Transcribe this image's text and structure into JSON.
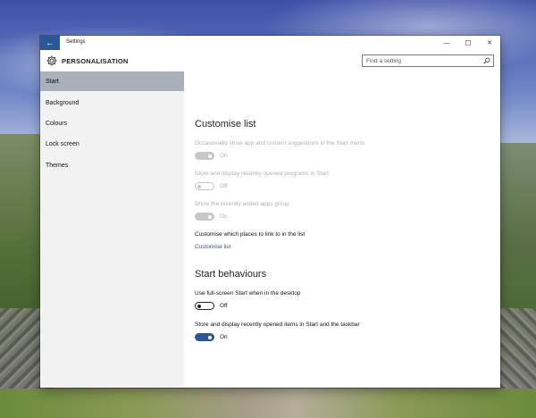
{
  "window": {
    "title": "Settings",
    "back_glyph": "←",
    "minimize_glyph": "—",
    "maximize_glyph": "☐",
    "close_glyph": "✕"
  },
  "header": {
    "title": "PERSONALISATION",
    "icon": "gear-icon",
    "search_placeholder": "Find a setting",
    "search_icon": "search-icon"
  },
  "sidebar": {
    "items": [
      {
        "label": "Start",
        "selected": true
      },
      {
        "label": "Background",
        "selected": false
      },
      {
        "label": "Colours",
        "selected": false
      },
      {
        "label": "Lock screen",
        "selected": false
      },
      {
        "label": "Themes",
        "selected": false
      }
    ]
  },
  "content": {
    "customise_list": {
      "heading": "Customise list",
      "suggestions": {
        "label": "Occasionally show app and content suggestions in the Start menu",
        "state": "On",
        "enabled": false
      },
      "recent_programs": {
        "label": "Store and display recently opened programs in Start",
        "state": "Off",
        "enabled": false
      },
      "recent_apps": {
        "label": "Show the recently added apps group",
        "state": "On",
        "enabled": false
      },
      "places_label": "Customise which places to link to in the list",
      "places_link": "Customise list"
    },
    "start_behaviours": {
      "heading": "Start behaviours",
      "full_screen": {
        "label": "Use full-screen Start when in the desktop",
        "state": "Off"
      },
      "recent_items": {
        "label": "Store and display recently opened items in Start and the taskbar",
        "state": "On"
      }
    }
  },
  "colors": {
    "accent": "#2b5797",
    "selected_nav": "#aab0b9",
    "sidebar_bg": "#f2f2f2"
  }
}
